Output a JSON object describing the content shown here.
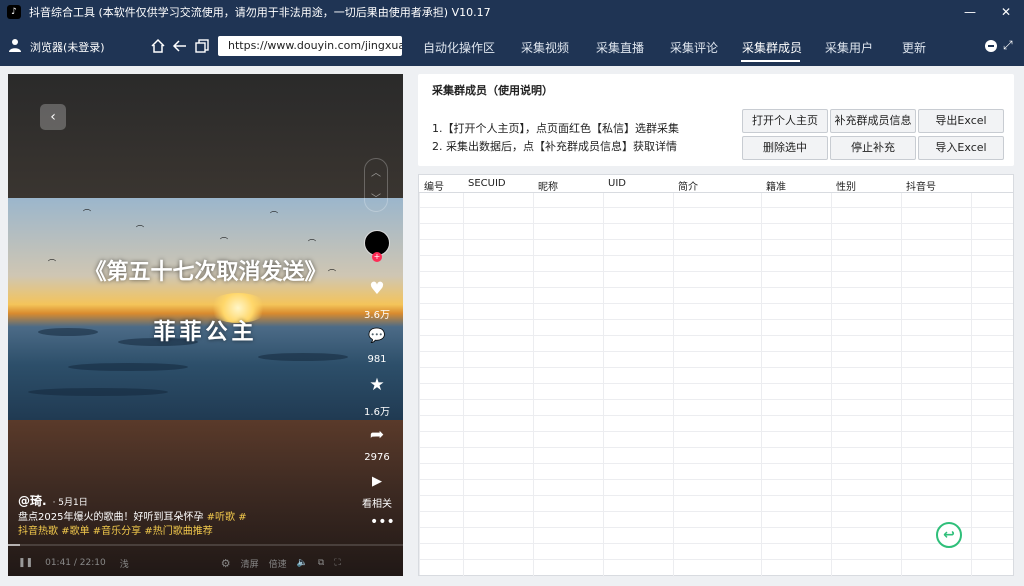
{
  "window": {
    "logo_glyph": "♪",
    "title": "抖音综合工具   (本软件仅供学习交流使用，请勿用于非法用途，一切后果由使用者承担)   V10.17",
    "min_glyph": "—",
    "max_glyph": "☐",
    "close_glyph": "✕"
  },
  "nav": {
    "user_label": "浏览器(未登录)",
    "url": "https://www.douyin.com/jingxuan",
    "tabs": [
      "自动化操作区",
      "采集视频",
      "采集直播",
      "采集评论",
      "采集群成员",
      "采集用户",
      "更新"
    ],
    "active_tab": "采集群成员",
    "expand_glyph": "⤢"
  },
  "video": {
    "back_glyph": "‹",
    "up_glyph": "︿",
    "down_glyph": "﹀",
    "title_text": "《第五十七次取消发送》",
    "subtitle_text": "菲菲公主",
    "avatar_plus": "+",
    "like_glyph": "♥",
    "like_count": "3.6万",
    "comment_glyph": "💬",
    "comment_count": "981",
    "fav_glyph": "★",
    "fav_count": "1.6万",
    "share_glyph": "➦",
    "share_count": "2976",
    "watch_glyph": "▶",
    "watch_label": "看相关",
    "more_glyph": "•••",
    "author": "@琦.",
    "date": "· 5月1日",
    "desc_text": "盘点2025年爆火的歌曲！好听到耳朵怀孕 ",
    "desc_tags": [
      "#听歌",
      "#",
      "抖音热歌",
      "#歌单",
      "#音乐分享",
      "#热门歌曲推荐"
    ],
    "progress": 0.03,
    "play_glyph": "❚❚",
    "time": "01:41 / 22:10",
    "speed_glyph": "浅",
    "gear_glyph": "⚙",
    "clear_label": "清屏",
    "rate_label": "倍速",
    "volume_glyph": "🔈",
    "pip_glyph": "⧉",
    "fullscreen_glyph": "⛶"
  },
  "info": {
    "title": "采集群成员（使用说明）",
    "line1": "1.【打开个人主页】，点页面红色【私信】选群采集",
    "line2": "2. 采集出数据后，点【补充群成员信息】获取详情",
    "buttons": {
      "open_profile": "打开个人主页",
      "supplement": "补充群成员信息",
      "export_excel": "导出Excel",
      "delete_selected": "删除选中",
      "stop_supplement": "停止补充",
      "import_excel": "导入Excel"
    }
  },
  "table": {
    "columns": [
      "编号",
      "SECUID",
      "昵称",
      "UID",
      "简介",
      "籍准",
      "性别",
      "抖音号"
    ]
  },
  "fab_glyph": "↩"
}
